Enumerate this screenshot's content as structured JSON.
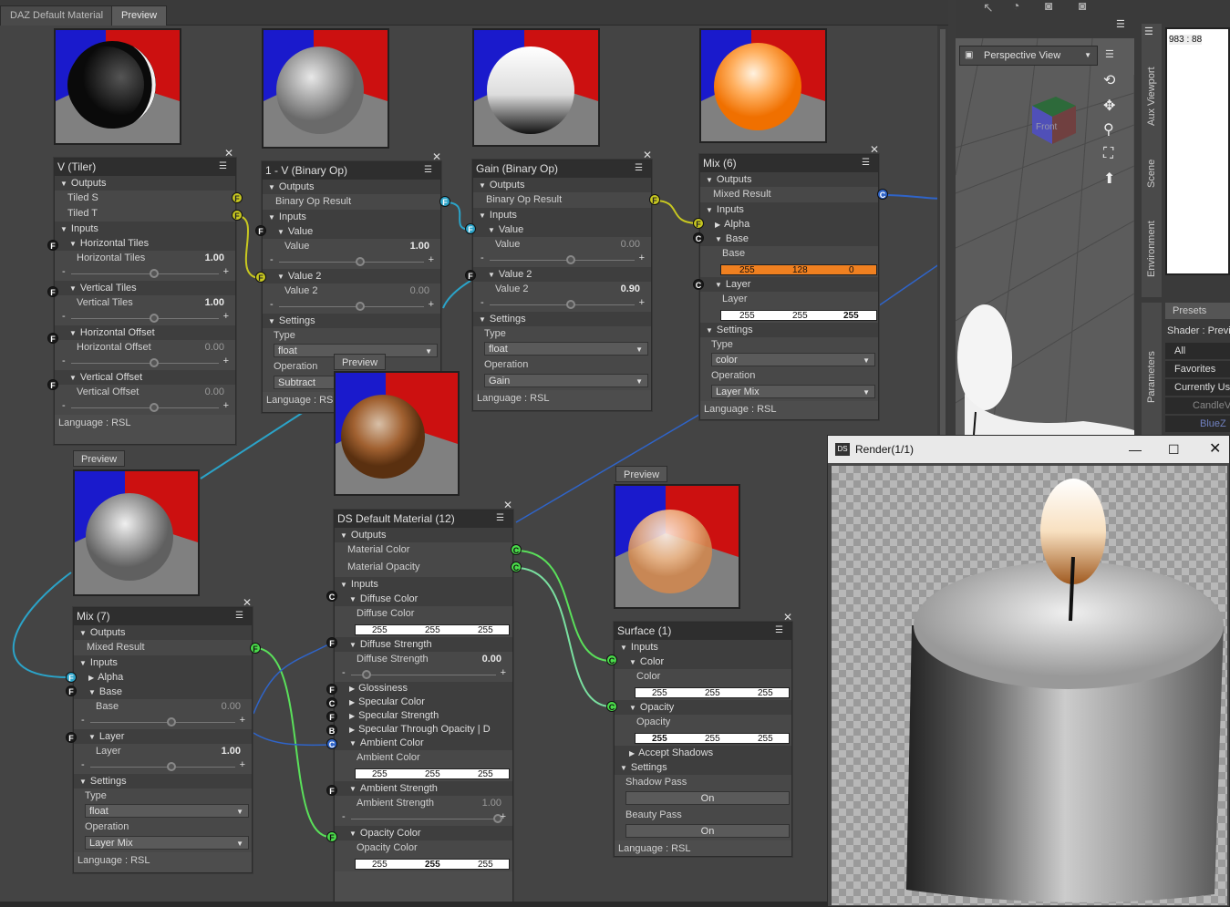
{
  "tabs": [
    "DAZ Default Material",
    "Preview"
  ],
  "preview_label": "Preview",
  "nodes": {
    "v_tiler": {
      "title": "V (Tiler)",
      "outputs": "Outputs",
      "tiled_s": "Tiled S",
      "tiled_t": "Tiled T",
      "inputs": "Inputs",
      "h_tiles": "Horizontal Tiles",
      "h_tiles_val": "1.00",
      "v_tiles": "Vertical Tiles",
      "v_tiles_val": "1.00",
      "h_offset": "Horizontal Offset",
      "h_offset_val": "0.00",
      "v_offset": "Vertical Offset",
      "v_offset_val": "0.00",
      "language": "Language : RSL"
    },
    "binary_op1": {
      "title": "1 - V (Binary Op)",
      "outputs": "Outputs",
      "result": "Binary Op Result",
      "inputs": "Inputs",
      "value": "Value",
      "value_val": "1.00",
      "value2": "Value 2",
      "value2_val": "0.00",
      "settings": "Settings",
      "type": "Type",
      "type_val": "float",
      "operation": "Operation",
      "operation_val": "Subtract",
      "language": "Language : RSL"
    },
    "gain": {
      "title": "Gain (Binary Op)",
      "outputs": "Outputs",
      "result": "Binary Op Result",
      "inputs": "Inputs",
      "value": "Value",
      "value_val": "0.00",
      "value2": "Value 2",
      "value2_val": "0.90",
      "settings": "Settings",
      "type": "Type",
      "type_val": "float",
      "operation": "Operation",
      "operation_val": "Gain",
      "language": "Language : RSL"
    },
    "mix6": {
      "title": "Mix (6)",
      "outputs": "Outputs",
      "mixed": "Mixed Result",
      "inputs": "Inputs",
      "alpha": "Alpha",
      "base": "Base",
      "base_rgb": [
        "255",
        "128",
        "0"
      ],
      "layer": "Layer",
      "layer_rgb": [
        "255",
        "255",
        "255"
      ],
      "settings": "Settings",
      "type": "Type",
      "type_val": "color",
      "operation": "Operation",
      "operation_val": "Layer Mix",
      "language": "Language : RSL"
    },
    "mix7": {
      "title": "Mix (7)",
      "outputs": "Outputs",
      "mixed": "Mixed Result",
      "inputs": "Inputs",
      "alpha": "Alpha",
      "base": "Base",
      "base_val": "0.00",
      "layer": "Layer",
      "layer_val": "1.00",
      "settings": "Settings",
      "type": "Type",
      "type_val": "float",
      "operation": "Operation",
      "operation_val": "Layer Mix",
      "language": "Language : RSL"
    },
    "ds_default": {
      "title": "DS Default Material (12)",
      "outputs": "Outputs",
      "material_color": "Material Color",
      "material_opacity": "Material Opacity",
      "inputs": "Inputs",
      "diffuse_color": "Diffuse Color",
      "diffuse_rgb": [
        "255",
        "255",
        "255"
      ],
      "diffuse_strength": "Diffuse Strength",
      "diffuse_strength_val": "0.00",
      "glossiness": "Glossiness",
      "specular_color": "Specular Color",
      "specular_strength": "Specular Strength",
      "specular_through": "Specular Through Opacity  | D",
      "ambient_color": "Ambient Color",
      "ambient_rgb": [
        "255",
        "255",
        "255"
      ],
      "ambient_strength": "Ambient Strength",
      "ambient_strength_val": "1.00",
      "opacity_color": "Opacity Color",
      "opacity_rgb": [
        "255",
        "255",
        "255"
      ]
    },
    "surface": {
      "title": "Surface (1)",
      "inputs": "Inputs",
      "color": "Color",
      "color_rgb": [
        "255",
        "255",
        "255"
      ],
      "opacity": "Opacity",
      "opacity_rgb": [
        "255",
        "255",
        "255"
      ],
      "accept_shadows": "Accept Shadows",
      "settings": "Settings",
      "shadow_pass": "Shadow Pass",
      "shadow_val": "On",
      "beauty_pass": "Beauty Pass",
      "beauty_val": "On",
      "language": "Language : RSL"
    }
  },
  "viewport": {
    "view_label": "Perspective View",
    "cube_label": "Front",
    "coords": "983 : 88"
  },
  "right_tabs": [
    "Aux Viewport",
    "Scene",
    "Environment",
    "Parameters"
  ],
  "presets": {
    "tab": "Presets",
    "shader": "Shader : Previ",
    "items": [
      "All",
      "Favorites",
      "Currently Us",
      "CandleV",
      "BlueZ"
    ]
  },
  "render": {
    "title": "Render(1/1)",
    "icon": "DS"
  },
  "colors": {
    "wire_cyan": "#2ba3c8",
    "wire_green": "#5ae05a",
    "wire_yellow": "#c8c820",
    "wire_blue": "#2f64c8",
    "orange": "#f08020"
  }
}
